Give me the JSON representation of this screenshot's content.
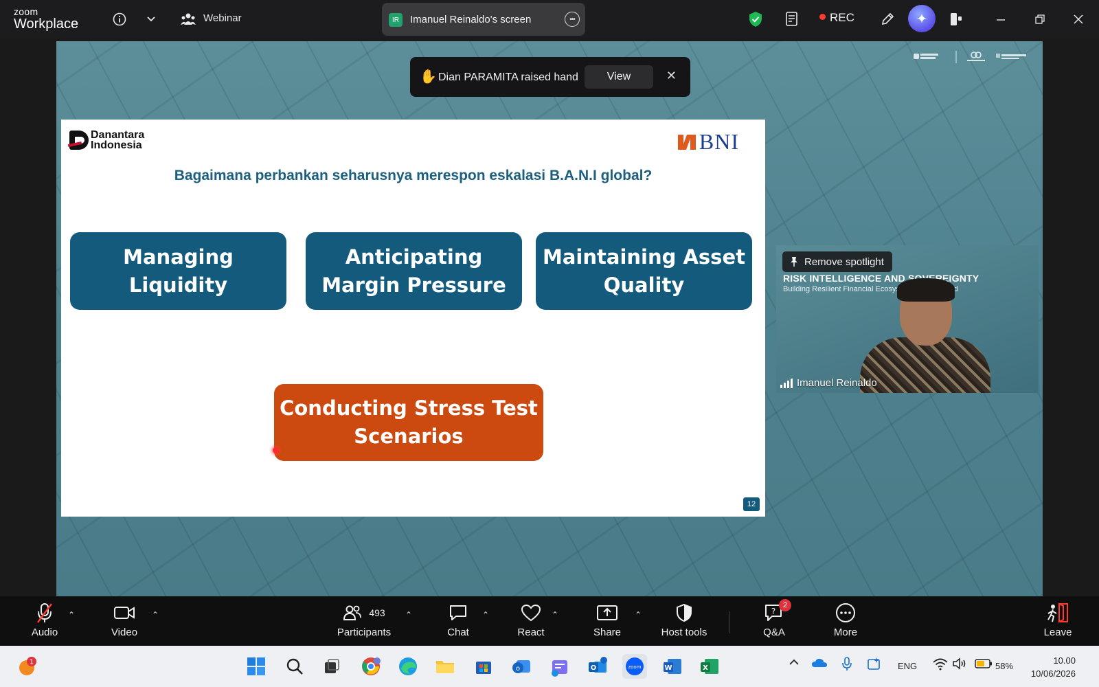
{
  "app": {
    "brand_line1": "zoom",
    "brand_line2": "Workplace",
    "mode": "Webinar",
    "share_title": "Imanuel Reinaldo's screen",
    "share_initials": "IR",
    "rec_label": "REC"
  },
  "notification": {
    "text": "Dian PARAMITA raised hand",
    "view_label": "View"
  },
  "slide": {
    "logo_left_line1": "Danantara",
    "logo_left_line2": "Indonesia",
    "logo_right": "BNI",
    "title": "Bagaimana perbankan seharusnya merespon eskalasi B.A.N.I global?",
    "boxes": [
      {
        "line1": "Managing",
        "line2": "Liquidity"
      },
      {
        "line1": "Anticipating",
        "line2": "Margin Pressure"
      },
      {
        "line1": "Maintaining Asset",
        "line2": "Quality"
      },
      {
        "line1": "Conducting Stress Test",
        "line2": "Scenarios"
      }
    ],
    "page_number": "12"
  },
  "speaker": {
    "spotlight_label": "Remove spotlight",
    "banner_title": "RISK INTELLIGENCE AND SOVEREIGNTY",
    "banner_subtitle": "Building Resilient Financial Ecosyst       Uncertain World",
    "name": "Imanuel Reinaldo"
  },
  "toolbar": {
    "audio": "Audio",
    "video": "Video",
    "participants": "Participants",
    "participants_count": "493",
    "chat": "Chat",
    "react": "React",
    "share": "Share",
    "host_tools": "Host tools",
    "qa": "Q&A",
    "qa_badge": "2",
    "more": "More",
    "leave": "Leave"
  },
  "taskbar": {
    "notif_badge": "1",
    "lang": "ENG",
    "battery": "58%",
    "time": "10.00",
    "date": "10/06/2026"
  },
  "colors": {
    "slide_teal": "#135a7c",
    "slide_orange": "#cc4a0f",
    "title_teal": "#1d5f7e",
    "rec_red": "#ff3b30"
  }
}
